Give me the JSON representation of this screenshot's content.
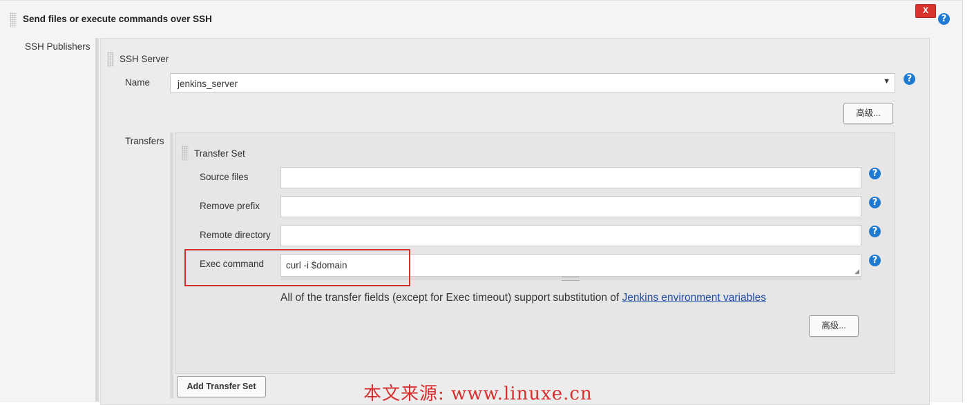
{
  "section": {
    "title": "Send files or execute commands over SSH",
    "close_label": "X",
    "help": "?"
  },
  "ssh_publishers": {
    "label": "SSH Publishers",
    "server_title": "SSH Server",
    "name_label": "Name",
    "name_value": "jenkins_server",
    "advanced_label": "高级...",
    "transfers_label": "Transfers"
  },
  "transfer_set": {
    "title": "Transfer Set",
    "source_files_label": "Source files",
    "source_files_value": "",
    "remove_prefix_label": "Remove prefix",
    "remove_prefix_value": "",
    "remote_directory_label": "Remote directory",
    "remote_directory_value": "",
    "exec_command_label": "Exec command",
    "exec_command_value": "curl -i $domain",
    "note_text": "All of the transfer fields (except for Exec timeout) support substitution of ",
    "note_link": "Jenkins environment variables",
    "advanced_label": "高级...",
    "add_button": "Add Transfer Set"
  },
  "watermark": "本文来源: www.linuxe.cn",
  "colors": {
    "help_blue": "#1f7bd1",
    "close_red": "#d9342b",
    "highlight_red": "#d4302e",
    "link_blue": "#1f4ba5"
  }
}
